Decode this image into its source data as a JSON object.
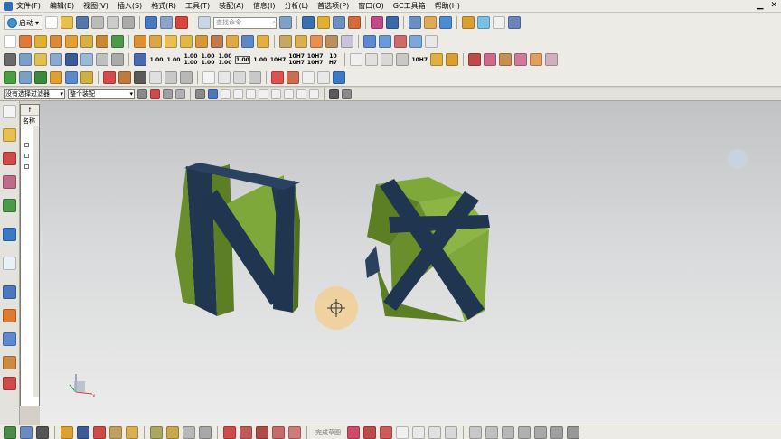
{
  "menu": {
    "items": [
      "文件(F)",
      "编辑(E)",
      "视图(V)",
      "插入(S)",
      "格式(R)",
      "工具(T)",
      "装配(A)",
      "信息(I)",
      "分析(L)",
      "首选项(P)",
      "窗口(O)",
      "GC工具箱",
      "帮助(H)"
    ]
  },
  "toolbar1": {
    "start_label": "启动",
    "search_placeholder": "查找命令"
  },
  "toolbar3": {
    "numeric_buttons": [
      "1.00",
      "1.00",
      "1.00\n1.00",
      "1.00\n1.00",
      "1.00\n1.00",
      "1.00",
      "1.00",
      "10H7",
      "10H7\n10H7",
      "10H7\n10H7",
      "10\nH7"
    ]
  },
  "selection_bar": {
    "filter_value": "没有选择过滤器",
    "scope_value": "整个装配"
  },
  "navigator": {
    "tab_label": "f",
    "column_header": "名称"
  },
  "statusbar": {
    "hint_label": "完成草图"
  },
  "colors": {
    "part_green": "#7fa83a",
    "part_green_dark": "#5d7f24",
    "part_navy": "#1f3550",
    "cursor_halo": "#f2cf95"
  },
  "icons": {
    "cursor": "move-crosshair-icon",
    "triad": "wcs-triad-icon"
  }
}
